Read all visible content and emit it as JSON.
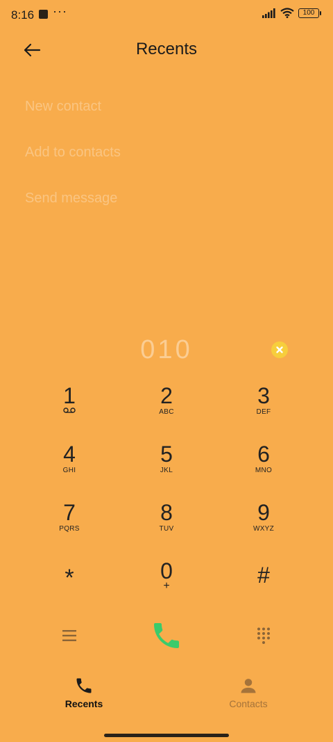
{
  "status_bar": {
    "time": "8:16",
    "dots": "···",
    "battery": "100"
  },
  "header": {
    "title": "Recents"
  },
  "actions": [
    {
      "label": "New contact"
    },
    {
      "label": "Add to contacts"
    },
    {
      "label": "Send message"
    }
  ],
  "dialer": {
    "number": "010"
  },
  "keypad": {
    "keys": [
      {
        "digit": "1",
        "letters": ""
      },
      {
        "digit": "2",
        "letters": "ABC"
      },
      {
        "digit": "3",
        "letters": "DEF"
      },
      {
        "digit": "4",
        "letters": "GHI"
      },
      {
        "digit": "5",
        "letters": "JKL"
      },
      {
        "digit": "6",
        "letters": "MNO"
      },
      {
        "digit": "7",
        "letters": "PQRS"
      },
      {
        "digit": "8",
        "letters": "TUV"
      },
      {
        "digit": "9",
        "letters": "WXYZ"
      },
      {
        "digit": "*",
        "letters": ""
      },
      {
        "digit": "0",
        "letters": "+"
      },
      {
        "digit": "#",
        "letters": ""
      }
    ]
  },
  "bottom_nav": {
    "recents_label": "Recents",
    "contacts_label": "Contacts"
  },
  "colors": {
    "background": "#F8AC4C",
    "call_green": "#3BCB6B",
    "clear_yellow": "#F7CE3C",
    "inactive_nav": "#A5733A"
  },
  "icons": {
    "back": "arrow-left-icon",
    "clear": "close-circle-icon",
    "voicemail": "voicemail-icon",
    "menu": "hamburger-menu-icon",
    "call": "phone-icon",
    "dialpad": "dialpad-grid-icon",
    "recents": "phone-icon",
    "contacts": "person-icon"
  }
}
